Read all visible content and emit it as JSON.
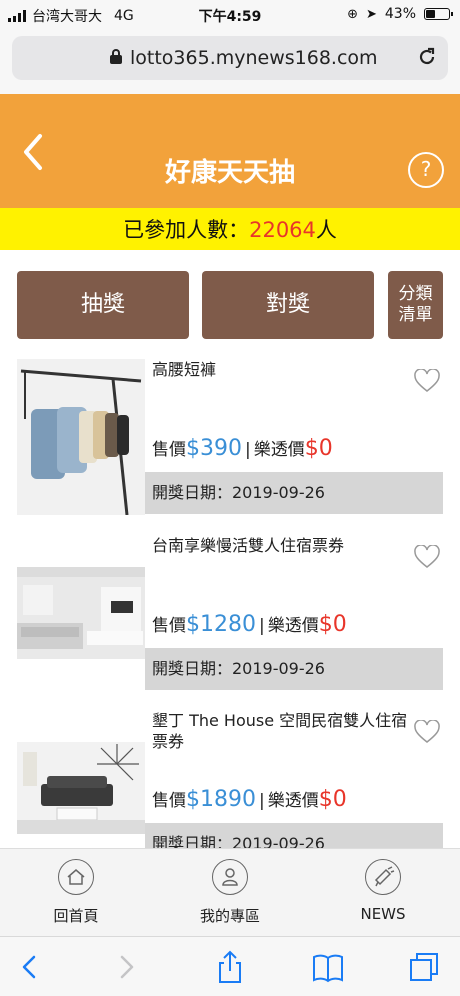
{
  "status_bar": {
    "carrier": "台湾大哥大",
    "network": "4G",
    "time": "下午4:59",
    "battery_text": "43%",
    "battery_level": 0.43
  },
  "browser": {
    "url": "lotto365.mynews168.com"
  },
  "header": {
    "title": "好康天天抽",
    "help_label": "?"
  },
  "participants": {
    "prefix": "已參加人數：",
    "count": "22064",
    "suffix": "人"
  },
  "actions": {
    "draw_label": "抽獎",
    "match_label": "對獎",
    "category_label_line1": "分類",
    "category_label_line2": "清單"
  },
  "products": [
    {
      "name": "高腰短褲",
      "price_label": "售價",
      "price": "$390",
      "separator": "|",
      "lotto_label": "樂透價",
      "lotto_price": "$0",
      "draw_date": "開獎日期：2019-09-26"
    },
    {
      "name": "台南享樂慢活雙人住宿票券",
      "price_label": "售價",
      "price": "$1280",
      "separator": "|",
      "lotto_label": "樂透價",
      "lotto_price": "$0",
      "draw_date": "開獎日期：2019-09-26"
    },
    {
      "name": "墾丁 The House 空間民宿雙人住宿票券",
      "price_label": "售價",
      "price": "$1890",
      "separator": "|",
      "lotto_label": "樂透價",
      "lotto_price": "$0",
      "draw_date": "開獎日期：2019-09-26"
    }
  ],
  "tabs": [
    {
      "label": "回首頁",
      "icon": "home-icon"
    },
    {
      "label": "我的專區",
      "icon": "user-icon"
    },
    {
      "label": "NEWS",
      "icon": "megaphone-icon"
    }
  ],
  "colors": {
    "header_orange": "#f2a23b",
    "banner_yellow": "#fff200",
    "button_brown": "#7f5b4a",
    "price_blue": "#3a8fd6",
    "lotto_red": "#e8352a",
    "ios_blue": "#1a7cf5"
  }
}
